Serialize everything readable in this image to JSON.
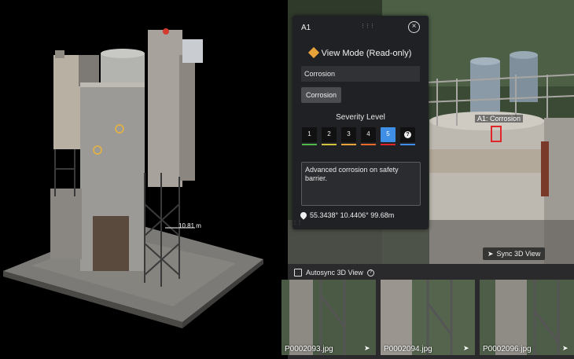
{
  "viewport": {
    "measurement": "10.81 m"
  },
  "photo": {
    "annotation_label": "A1: Corrosion",
    "sync_button_label": "Sync 3D View",
    "sync_icon": "navigate-arrow-icon"
  },
  "panel": {
    "title": "A1",
    "view_mode": "View Mode (Read-only)",
    "name_value": "Corrosion",
    "tag": "Corrosion",
    "severity_label": "Severity Level",
    "severity_levels": [
      {
        "label": "1",
        "color": "#4fb84a"
      },
      {
        "label": "2",
        "color": "#d4c23a"
      },
      {
        "label": "3",
        "color": "#e8a33a"
      },
      {
        "label": "4",
        "color": "#e86a2a"
      },
      {
        "label": "5",
        "color": "#e0262a"
      },
      {
        "label": "?",
        "color": "#3f8fe6"
      }
    ],
    "selected_severity": "5",
    "description": "Advanced corrosion on safety barrier.",
    "coordinates": "55.3438° 10.4406° 99.68m",
    "accent_color": "#3f8fe6",
    "warning_color": "#e8a33a"
  },
  "filmstrip": {
    "autosync_label": "Autosync 3D View",
    "thumbnails": [
      {
        "name": "P0002093.jpg"
      },
      {
        "name": "P0002094.jpg"
      },
      {
        "name": "P0002096.jpg"
      }
    ]
  }
}
